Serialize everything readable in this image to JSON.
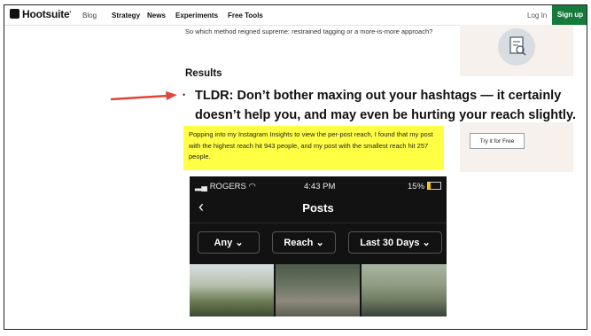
{
  "nav": {
    "logo": "Hootsuite",
    "links": [
      "Blog",
      "Strategy",
      "News",
      "Experiments",
      "Free Tools"
    ],
    "login": "Log In",
    "signup": "Sign up"
  },
  "article": {
    "intro": "So which method reigned supreme: restrained tagging or a more-is-more approach?",
    "results_heading": "Results",
    "bullet": "•",
    "tldr": "TLDR: Don’t bother maxing out your hashtags — it certainly doesn’t help you, and may even be hurting your reach slightly.",
    "highlight": "Popping into my Instagram Insights to view the per-post reach, I found that my post with the highest reach hit 943 people, and my post with the smallest reach hit 257 people."
  },
  "sidebar": {
    "cta": "Try it for Free"
  },
  "phone": {
    "carrier": "ROGERS",
    "time": "4:43 PM",
    "battery": "15%",
    "title": "Posts",
    "filters": [
      "Any",
      "Reach",
      "Last 30 Days"
    ]
  },
  "colors": {
    "signup_bg": "#157a3b",
    "highlight": "#ffff44",
    "arrow": "#e0443a"
  }
}
